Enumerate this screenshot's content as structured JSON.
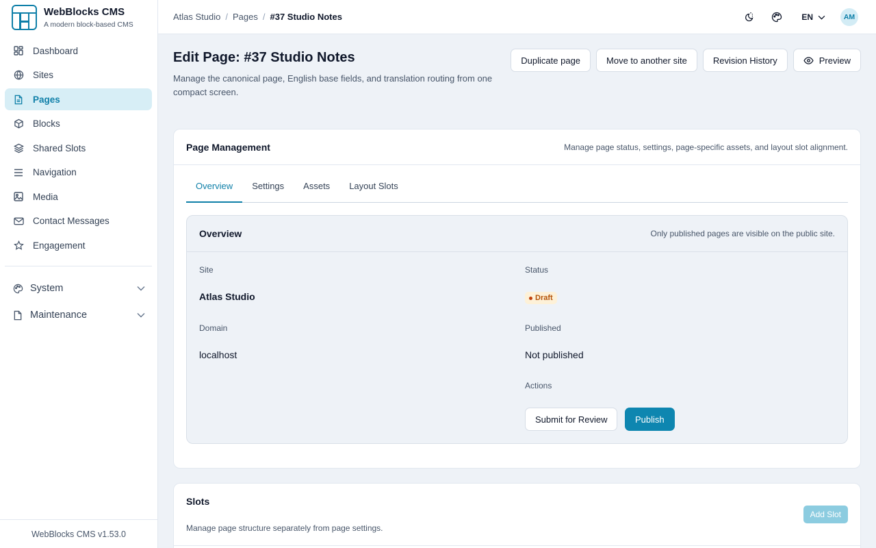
{
  "brand": {
    "name": "WebBlocks CMS",
    "tagline": "A modern block-based CMS"
  },
  "sidebar": {
    "items": [
      {
        "label": "Dashboard",
        "icon": "dashboard-icon"
      },
      {
        "label": "Sites",
        "icon": "globe-icon"
      },
      {
        "label": "Pages",
        "icon": "file-icon",
        "active": true
      },
      {
        "label": "Blocks",
        "icon": "cube-icon"
      },
      {
        "label": "Shared Slots",
        "icon": "layers-icon"
      },
      {
        "label": "Navigation",
        "icon": "menu-icon"
      },
      {
        "label": "Media",
        "icon": "image-icon"
      },
      {
        "label": "Contact Messages",
        "icon": "mail-icon"
      },
      {
        "label": "Engagement",
        "icon": "star-icon"
      }
    ],
    "groups": [
      {
        "label": "System",
        "icon": "palette-icon"
      },
      {
        "label": "Maintenance",
        "icon": "file-icon"
      }
    ],
    "footer": "WebBlocks CMS v1.53.0"
  },
  "topbar": {
    "breadcrumbs": [
      "Atlas Studio",
      "Pages",
      "#37 Studio Notes"
    ],
    "separator": "/",
    "language": "EN",
    "avatar_initials": "AM"
  },
  "page": {
    "title": "Edit Page: #37 Studio Notes",
    "description": "Manage the canonical page, English base fields, and translation routing from one compact screen.",
    "actions": {
      "duplicate": "Duplicate page",
      "move": "Move to another site",
      "history": "Revision History",
      "preview": "Preview"
    }
  },
  "management": {
    "title": "Page Management",
    "hint": "Manage page status, settings, page-specific assets, and layout slot alignment.",
    "tabs": [
      "Overview",
      "Settings",
      "Assets",
      "Layout Slots"
    ],
    "active_tab": "Overview",
    "overview": {
      "title": "Overview",
      "hint": "Only published pages are visible on the public site.",
      "site_label": "Site",
      "site_value": "Atlas Studio",
      "status_label": "Status",
      "status_value": "Draft",
      "domain_label": "Domain",
      "domain_value": "localhost",
      "published_label": "Published",
      "published_value": "Not published",
      "actions_label": "Actions",
      "submit_label": "Submit for Review",
      "publish_label": "Publish"
    }
  },
  "slots": {
    "title": "Slots",
    "description": "Manage page structure separately from page settings.",
    "add_label": "Add Slot"
  },
  "colors": {
    "accent": "#0e86b0",
    "active_bg": "#d7eef6",
    "draft_badge_bg": "#fdf1d8",
    "draft_badge_text": "#b45309"
  }
}
